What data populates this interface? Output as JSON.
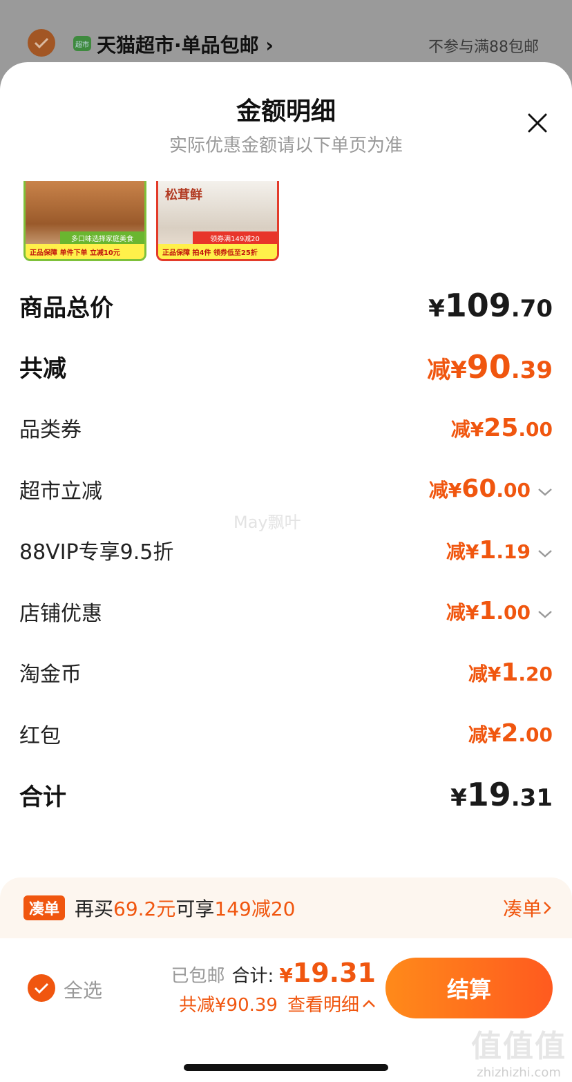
{
  "background": {
    "store_name": "天猫超市·单品包邮",
    "store_badge": "超市",
    "store_note": "不参与满88包邮"
  },
  "sheet": {
    "title": "金额明细",
    "subtitle": "实际优惠金额请以下单页为准"
  },
  "products": [
    {
      "mid": "多口味选择家庭美食",
      "strip": "正品保障  单件下单 立减10元"
    },
    {
      "brand": "松茸鲜",
      "mid": "领券满149减20",
      "strip": "正品保障  拍4件 领券低至25折"
    }
  ],
  "rows": [
    {
      "label": "商品总价",
      "prefix": "¥",
      "int": "109",
      "dec": ".70"
    },
    {
      "label": "共减",
      "prefix": "减¥",
      "int": "90",
      "dec": ".39"
    },
    {
      "label": "品类券",
      "prefix": "减¥",
      "int": "25",
      "dec": ".00"
    },
    {
      "label": "超市立减",
      "prefix": "减¥",
      "int": "60",
      "dec": ".00"
    },
    {
      "label": "88VIP专享9.5折",
      "prefix": "减¥",
      "int": "1",
      "dec": ".19"
    },
    {
      "label": "店铺优惠",
      "prefix": "减¥",
      "int": "1",
      "dec": ".00"
    },
    {
      "label": "淘金币",
      "prefix": "减¥",
      "int": "1",
      "dec": ".20"
    },
    {
      "label": "红包",
      "prefix": "减¥",
      "int": "2",
      "dec": ".00"
    },
    {
      "label": "合计",
      "prefix": "¥",
      "int": "19",
      "dec": ".31"
    }
  ],
  "watermark": "May飘叶",
  "promo": {
    "tag": "凑单",
    "text_a": "再买",
    "amount": "69.2元",
    "text_b": "可享",
    "deal": "149减20",
    "link": "凑单"
  },
  "bottom": {
    "select_all": "全选",
    "shipped": "已包邮",
    "total_label": "合计:",
    "total_prefix": "¥",
    "total_value": "19.31",
    "saved": "共减¥90.39",
    "detail_link": "查看明细",
    "checkout": "结算"
  },
  "corner_mark": {
    "big": "值值值",
    "small": "zhizhizhi.com"
  },
  "colors": {
    "accent": "#f0560f",
    "checkout_start": "#ff8a1a",
    "checkout_end": "#ff5a1f"
  }
}
